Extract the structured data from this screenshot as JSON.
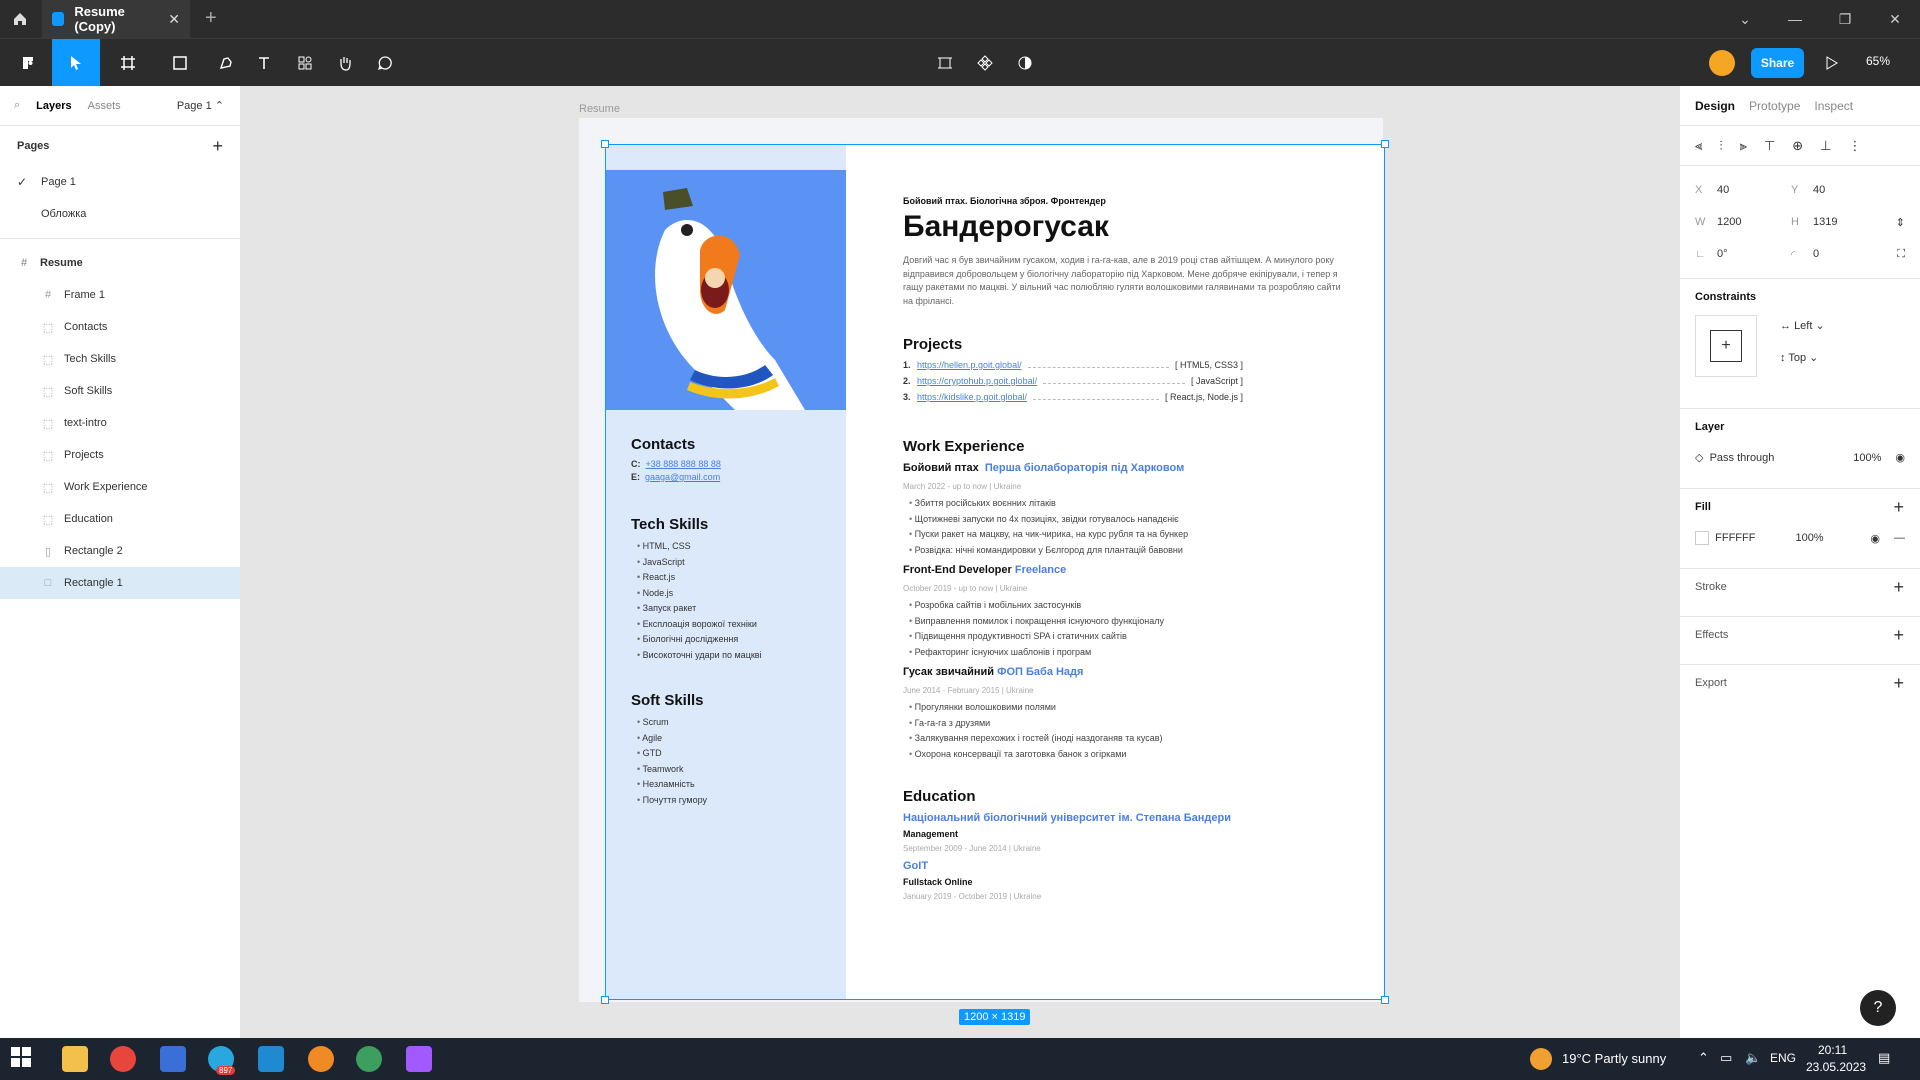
{
  "app": {
    "tab_title": "Resume (Copy)",
    "zoom": "65%",
    "share_label": "Share"
  },
  "left_panel": {
    "tab_layers": "Layers",
    "tab_assets": "Assets",
    "current_page": "Page 1",
    "pages_heading": "Pages",
    "pages": [
      "Page 1",
      "Обложка"
    ],
    "root_layer": "Resume",
    "layers": [
      "Frame 1",
      "Contacts",
      "Tech Skills",
      "Soft Skills",
      "text-intro",
      "Projects",
      "Work Experience",
      "Education",
      "Rectangle 2",
      "Rectangle 1"
    ]
  },
  "canvas": {
    "frame_label": "Resume",
    "size_badge": "1200 × 1319"
  },
  "resume": {
    "subtitle": "Бойовий птах. Біологічна зброя. Фронтендер",
    "name": "Бандерогусак",
    "intro": "Довгий час я був звичайним гусаком, ходив і га-га-кав, але в 2019 році став айтішцем. А минулого року відправився добровольцем у біологічну лабораторію під Харковом. Мене добряче екіпірували, і тепер я гащу ракетами по мацкві. У вільний час полюбляю гуляти волошковими галявинами та розробляю сайти на фрілансі.",
    "contacts": {
      "heading": "Contacts",
      "phone_label": "C:",
      "phone": "+38 888 888 88 88",
      "email_label": "E:",
      "email": "gaaga@gmail.com"
    },
    "tech_skills": {
      "heading": "Tech Skills",
      "items": [
        "HTML, CSS",
        "JavaScript",
        "React.js",
        "Node.js",
        "Запуск ракет",
        "Експлоація ворожої техніки",
        "Біологічні дослідження",
        "Високоточні удари по мацкві"
      ]
    },
    "soft_skills": {
      "heading": "Soft Skills",
      "items": [
        "Scrum",
        "Agile",
        "GTD",
        "Teamwork",
        "Незламність",
        "Почуття гумору"
      ]
    },
    "projects": {
      "heading": "Projects",
      "items": [
        {
          "num": "1.",
          "url": "https://hellen.p.goit.global/",
          "tech": "[ HTML5, CSS3 ]"
        },
        {
          "num": "2.",
          "url": "https://cryptohub.p.goit.global/",
          "tech": "[ JavaScript ]"
        },
        {
          "num": "3.",
          "url": "https://kidslike.p.goit.global/",
          "tech": "[ React.js, Node.js ]"
        }
      ]
    },
    "work": {
      "heading": "Work Experience",
      "jobs": [
        {
          "title": "Бойовий птах",
          "company": "Перша біолабораторія під Харковом",
          "meta": "March 2022 - up to now  |  Ukraine",
          "bullets": [
            "Збиття російських воєнних літаків",
            "Щотижневі запуски по 4х позиціях, звідки готувалось нападєніє",
            "Пуски ракет на мацкву, на чик-чирика, на курс рубля та на бункер",
            "Розвідка: нічні командировки у Бєлгород для плантацій бавовни"
          ]
        },
        {
          "title": "Front-End Developer",
          "company": "Freelance",
          "meta": "October 2019 - up to now  |  Ukraine",
          "bullets": [
            "Розробка сайтів і мобільних застосунків",
            "Виправлення помилок і покращення існуючого функціоналу",
            "Підвищення продуктивності SPA і статичних сайтів",
            "Рефакторинг існуючих шаблонів і програм"
          ]
        },
        {
          "title": "Гусак звичайний",
          "company": "ФОП Баба Надя",
          "meta": "June 2014 - February 2015  |  Ukraine",
          "bullets": [
            "Прогулянки волошковими полями",
            "Га-га-га з друзями",
            "Залякування перехожих і гостей (іноді наздоганяв та кусав)",
            "Охорона консервації та заготовка банок з огірками"
          ]
        }
      ]
    },
    "education": {
      "heading": "Education",
      "items": [
        {
          "school": "Національний біологічний університет ім. Степана Бандери",
          "degree": "Management",
          "meta": "September 2009 - June 2014  |  Ukraine"
        },
        {
          "school": "GoIT",
          "degree": "Fullstack Online",
          "meta": "January 2019 - October 2019  |  Ukraine"
        }
      ]
    }
  },
  "right_panel": {
    "tab_design": "Design",
    "tab_prototype": "Prototype",
    "tab_inspect": "Inspect",
    "x": "40",
    "y": "40",
    "w": "1200",
    "h": "1319",
    "rotation": "0°",
    "radius": "0",
    "constraints_heading": "Constraints",
    "constraint_h": "Left",
    "constraint_v": "Top",
    "layer_heading": "Layer",
    "blend": "Pass through",
    "layer_opacity": "100%",
    "fill_heading": "Fill",
    "fill_hex": "FFFFFF",
    "fill_opacity": "100%",
    "stroke_heading": "Stroke",
    "effects_heading": "Effects",
    "export_heading": "Export"
  },
  "taskbar": {
    "weather": "19°C  Partly sunny",
    "lang": "ENG",
    "time": "20:11",
    "date": "23.05.2023",
    "badge": "897"
  }
}
